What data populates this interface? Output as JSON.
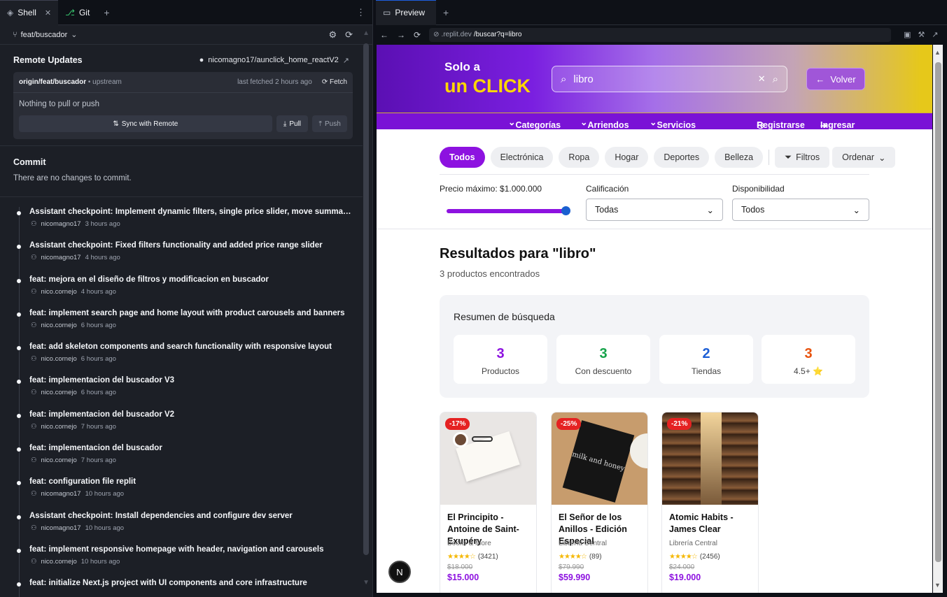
{
  "left": {
    "tabs": [
      {
        "label": "Shell"
      },
      {
        "label": "Git"
      }
    ],
    "branch": "feat/buscador",
    "remote": {
      "title": "Remote Updates",
      "repo": "nicomagno17/aunclick_home_reactV2",
      "branch_name": "origin/feat/buscador",
      "upstream": "• upstream",
      "last_fetched": "last fetched 2 hours ago",
      "fetch": "Fetch",
      "status": "Nothing to pull or push",
      "sync": "Sync with Remote",
      "pull": "Pull",
      "push": "Push"
    },
    "commit": {
      "title": "Commit",
      "empty": "There are no changes to commit."
    },
    "log": [
      {
        "msg": "Assistant checkpoint: Implement dynamic filters, single price slider, move summary...",
        "author": "nicomagno17",
        "time": "3 hours ago"
      },
      {
        "msg": "Assistant checkpoint: Fixed filters functionality and added price range slider",
        "author": "nicomagno17",
        "time": "4 hours ago"
      },
      {
        "msg": "feat: mejora en el diseño de filtros y modificacion en buscador",
        "author": "nico.cornejo",
        "time": "4 hours ago"
      },
      {
        "msg": "feat: implement search page and home layout with product carousels and banners",
        "author": "nico.cornejo",
        "time": "6 hours ago"
      },
      {
        "msg": "feat: add skeleton components and search functionality with responsive layout",
        "author": "nico.cornejo",
        "time": "6 hours ago"
      },
      {
        "msg": "feat: implementacion del buscador V3",
        "author": "nico.cornejo",
        "time": "6 hours ago"
      },
      {
        "msg": "feat: implementacion del buscador V2",
        "author": "nico.cornejo",
        "time": "7 hours ago"
      },
      {
        "msg": "feat: implementacion del buscador",
        "author": "nico.cornejo",
        "time": "7 hours ago"
      },
      {
        "msg": "feat: configuration file replit",
        "author": "nicomagno17",
        "time": "10 hours ago"
      },
      {
        "msg": "Assistant checkpoint: Install dependencies and configure dev server",
        "author": "nicomagno17",
        "time": "10 hours ago"
      },
      {
        "msg": "feat: implement responsive homepage with header, navigation and carousels",
        "author": "nico.cornejo",
        "time": "10 hours ago"
      },
      {
        "msg": "feat: initialize Next.js project with UI components and core infrastructure",
        "author": "",
        "time": ""
      }
    ]
  },
  "right": {
    "tab": "Preview",
    "url_prefix": ".replit.dev",
    "url_path": "/buscar?q=libro",
    "site": {
      "brand_top": "Solo a",
      "brand_bottom": "un CLICK",
      "search_value": "libro",
      "back": "Volver",
      "nav": [
        "Categorías",
        "Arriendos",
        "Servicios",
        "Registrarse",
        "Ingresar"
      ],
      "chips": [
        "Todos",
        "Electrónica",
        "Ropa",
        "Hogar",
        "Deportes",
        "Belleza"
      ],
      "filters": "Filtros",
      "sort": "Ordenar",
      "price_label": "Precio máximo: $1.000.000",
      "price_level": 1.0,
      "rating_label": "Calificación",
      "rating_value": "Todas",
      "avail_label": "Disponibilidad",
      "avail_value": "Todos",
      "results_title": "Resultados para \"libro\"",
      "results_count": "3 productos encontrados",
      "summary_title": "Resumen de búsqueda",
      "stats": [
        {
          "n": "3",
          "l": "Productos",
          "color": "#8d12e0"
        },
        {
          "n": "3",
          "l": "Con descuento",
          "color": "#16a34a"
        },
        {
          "n": "2",
          "l": "Tiendas",
          "color": "#1d5fd6"
        },
        {
          "n": "3",
          "l": "4.5+ ⭐",
          "color": "#e8530e"
        }
      ],
      "products": [
        {
          "badge": "-17%",
          "title": "El Principito - Antoine de Saint-Exupéry",
          "store": "Books & More",
          "rating": 4.5,
          "reviews": "(3421)",
          "old": "$18.000",
          "price": "$15.000"
        },
        {
          "badge": "-25%",
          "title": "El Señor de los Anillos - Edición Especial",
          "store": "Librería Central",
          "rating": 4.5,
          "reviews": "(89)",
          "old": "$79.990",
          "price": "$59.990"
        },
        {
          "badge": "-21%",
          "title": "Atomic Habits - James Clear",
          "store": "Librería Central",
          "rating": 4.5,
          "reviews": "(2456)",
          "old": "$24.000",
          "price": "$19.000"
        }
      ],
      "book_cover_text": "milk and honey",
      "next_badge": "N"
    }
  }
}
